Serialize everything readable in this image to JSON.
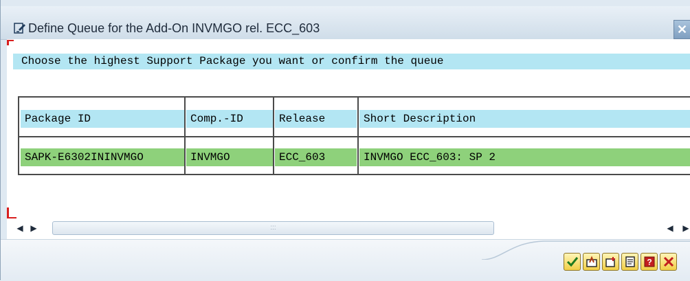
{
  "window": {
    "title": "Define Queue for the Add-On INVMGO rel. ECC_603",
    "title_icon": "edit-icon",
    "close_label": "✕"
  },
  "banner": {
    "text": "Choose the highest Support Package you want or confirm the queue"
  },
  "table": {
    "columns": [
      "Package ID",
      "Comp.-ID",
      "Release",
      "Short Description"
    ],
    "rows": [
      [
        "SAPK-E6302ININVMGO",
        "INVMGO",
        "ECC_603",
        "INVMGO ECC_603: SP 2"
      ]
    ]
  },
  "scrollbar": {
    "left_arrows": "◀ ▶",
    "right_arrows": "◀ ▶",
    "grip": ":::"
  },
  "toolbar": {
    "buttons": [
      {
        "name": "confirm-button",
        "icon": "checkmark-icon"
      },
      {
        "name": "select-button",
        "icon": "select-icon"
      },
      {
        "name": "add-button",
        "icon": "add-icon"
      },
      {
        "name": "list-button",
        "icon": "list-icon"
      },
      {
        "name": "help-button",
        "icon": "help-icon"
      },
      {
        "name": "cancel-button",
        "icon": "cancel-icon"
      }
    ]
  },
  "colors": {
    "header_bg": "#b3e6f3",
    "row_bg": "#8ed17b",
    "button_bg": "#f1cf46"
  }
}
